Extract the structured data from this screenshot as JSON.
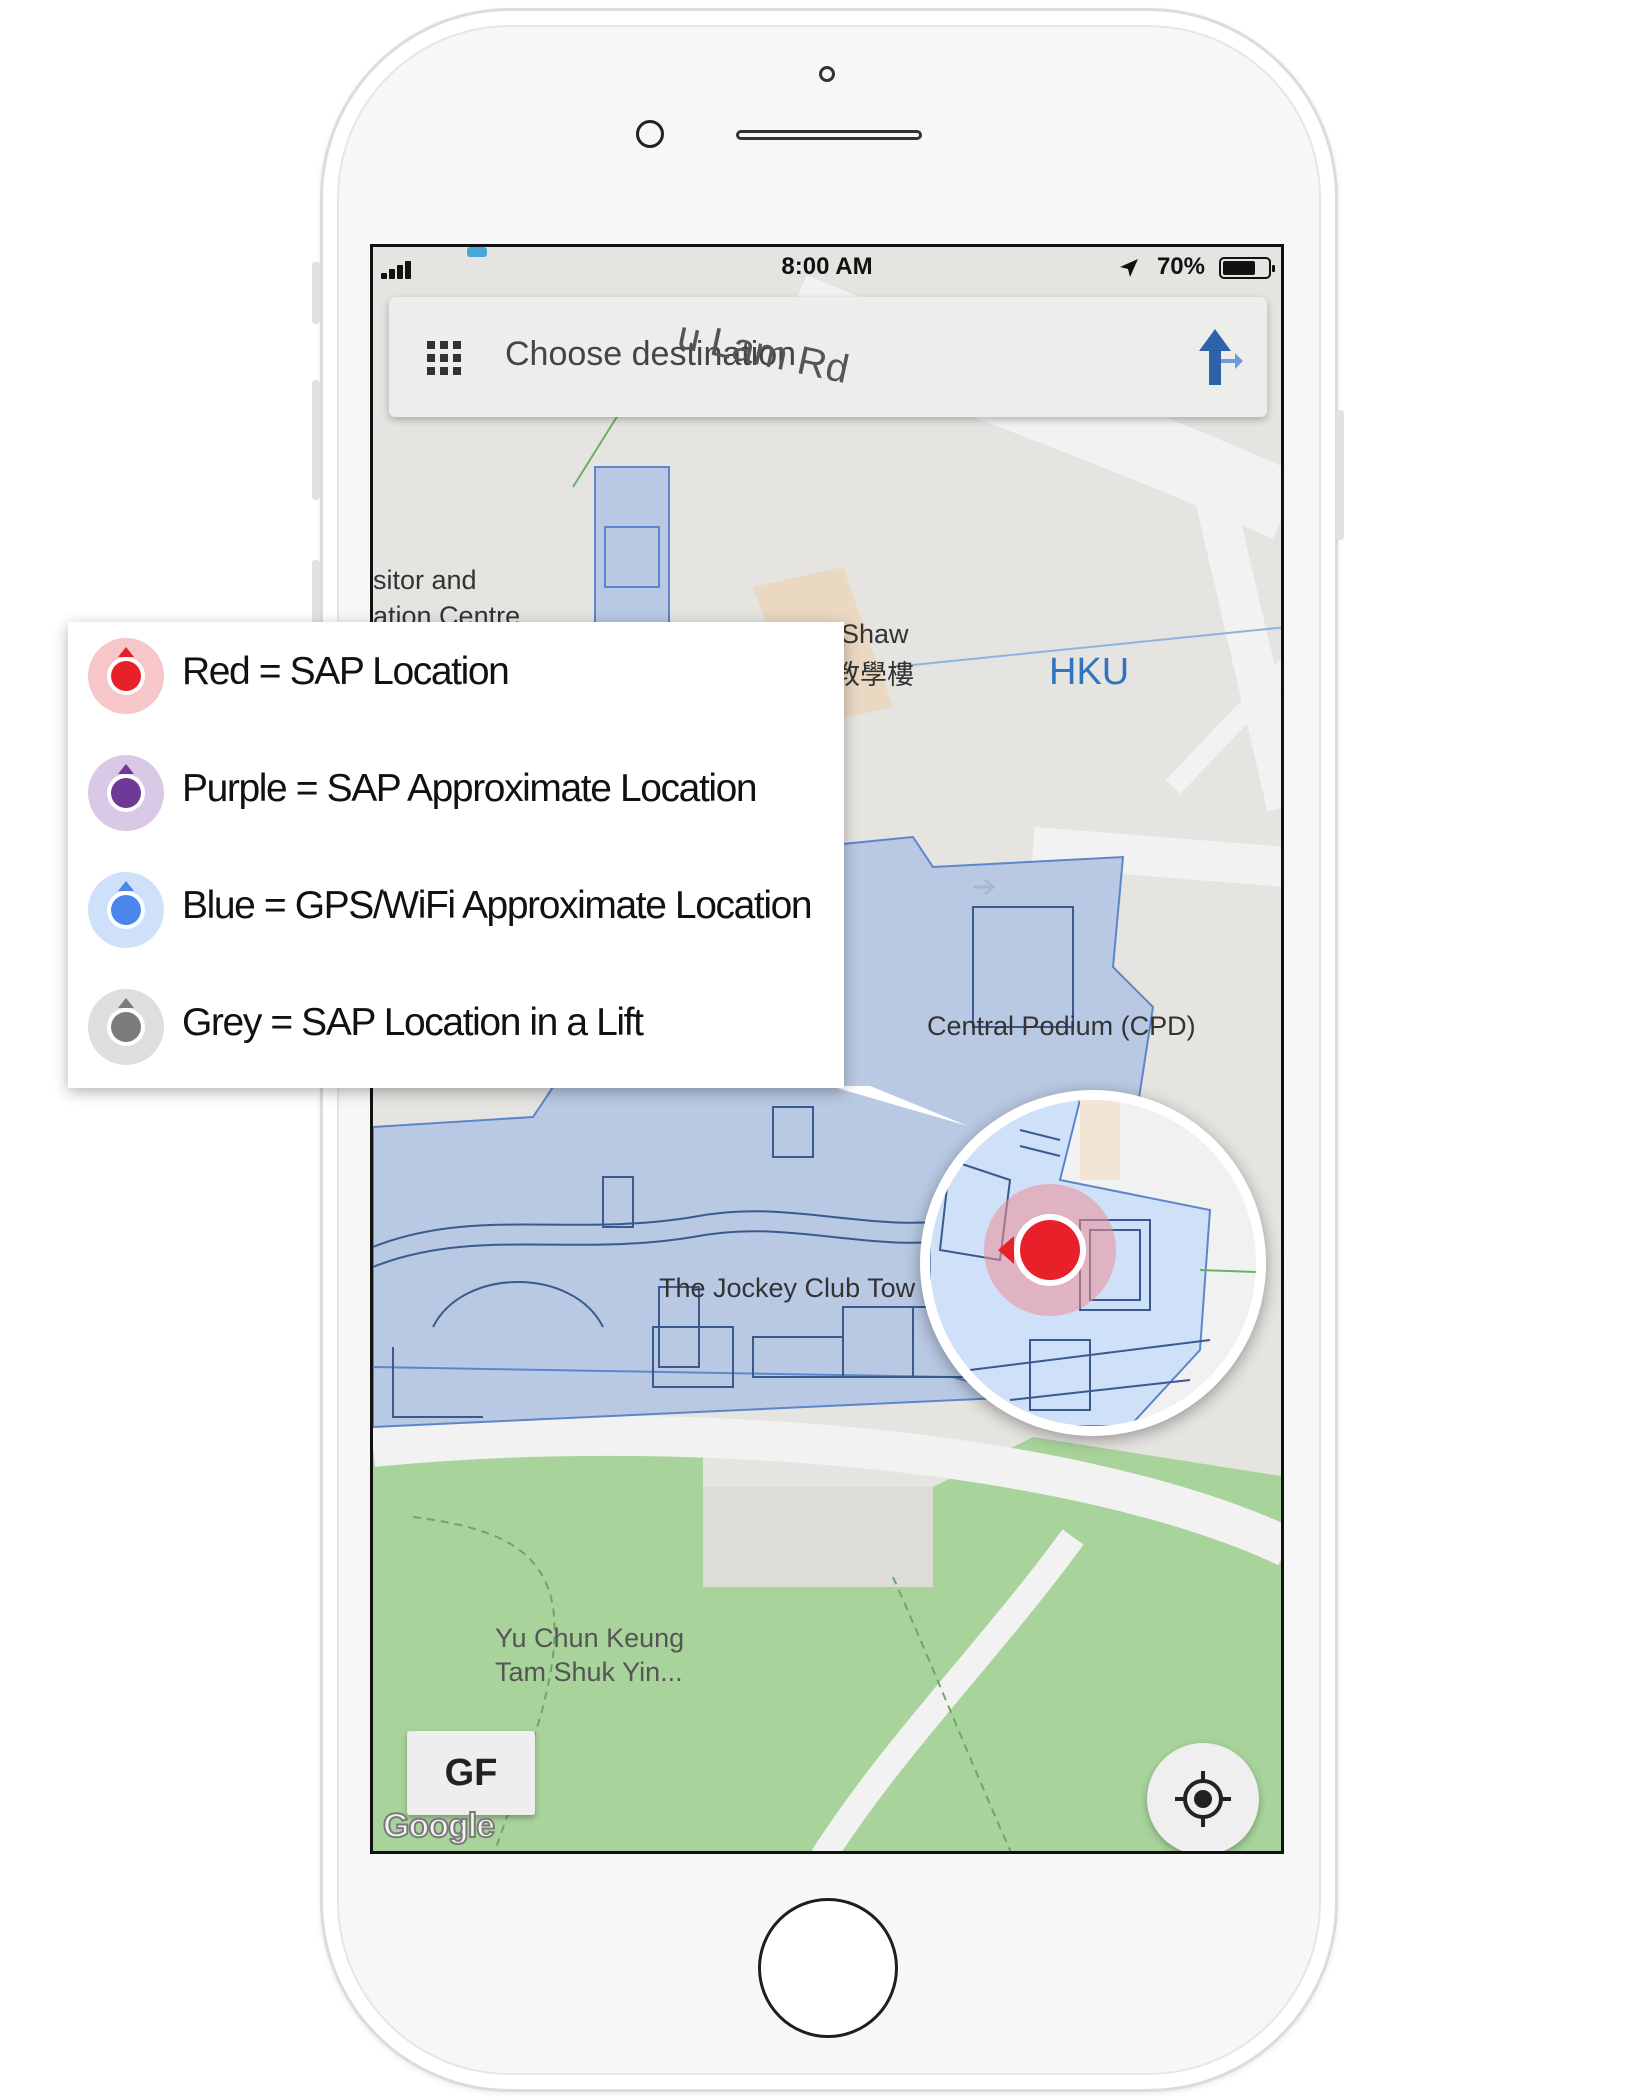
{
  "status_bar": {
    "time": "8:00 AM",
    "battery": "70%",
    "signal_icon": "cellular-signal-icon",
    "location_icon": "location-arrow-icon",
    "battery_icon": "battery-icon"
  },
  "search": {
    "placeholder": "Choose destination",
    "menu_icon": "grid-menu-icon",
    "directions_icon": "directions-arrow-icon"
  },
  "map": {
    "labels": {
      "road": "u Lam Rd",
      "visitor_line1": "sitor and",
      "visitor_line2": "ation Centre",
      "shaw_line1": "Shaw",
      "shaw_line2": "教學樓",
      "hku": "HKU",
      "central_podium": "Central Podium (CPD)",
      "jockey_club": "The Jockey Club Tow",
      "yu_chun_line1": "Yu Chun Keung",
      "yu_chun_line2": "Tam Shuk Yin..."
    },
    "floor_button": "GF",
    "attribution": "Google",
    "locate_icon": "my-location-icon",
    "colors": {
      "building_fill": "#b9c9e3",
      "building_stroke": "#5d86c9",
      "park_green": "#a8d39b",
      "road": "#f2f2f2",
      "ground": "#e6e4e1",
      "hku_label": "#2f74c0"
    }
  },
  "legend": {
    "items": [
      {
        "text": "Red = SAP Location",
        "color": "#e8202a",
        "halo": "#f6c6c8",
        "icon": "red-location-marker-icon"
      },
      {
        "text": "Purple = SAP Approximate Location",
        "color": "#6f3a97",
        "halo": "#d9c8e6",
        "icon": "purple-location-marker-icon"
      },
      {
        "text": "Blue = GPS/WiFi Approximate Location",
        "color": "#4b86ea",
        "halo": "#cfe0fb",
        "icon": "blue-location-marker-icon"
      },
      {
        "text": "Grey = SAP Location in a Lift",
        "color": "#7b7b7b",
        "halo": "#dedede",
        "icon": "grey-location-marker-icon"
      }
    ]
  },
  "magnifier": {
    "marker_color": "#e8202a",
    "marker_icon": "red-location-marker-icon"
  }
}
